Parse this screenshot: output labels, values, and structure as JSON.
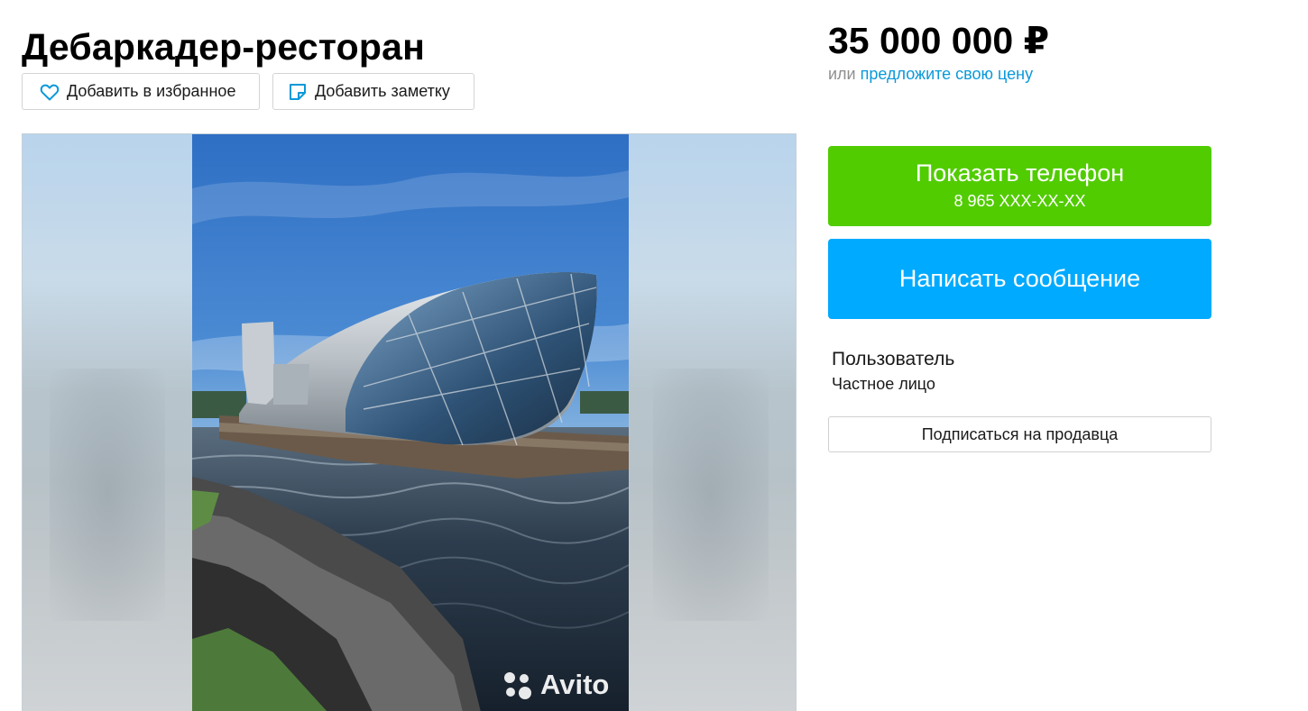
{
  "listing": {
    "title": "Дебаркадер-ресторан"
  },
  "actions": {
    "favorite_label": "Добавить в избранное",
    "note_label": "Добавить заметку",
    "favorite_icon": "heart-icon",
    "note_icon": "sticky-note-icon"
  },
  "gallery": {
    "watermark_text": "Avito",
    "watermark_icon": "avito-dots-icon"
  },
  "pricing": {
    "price": "35 000 000 ₽",
    "offer_prefix": "или",
    "offer_link": "предложите свою цену"
  },
  "contact": {
    "show_phone_label": "Показать телефон",
    "phone_masked": "8 965 XXX-XX-XX",
    "message_label": "Написать сообщение"
  },
  "seller": {
    "name": "Пользователь",
    "type": "Частное лицо",
    "subscribe_label": "Подписаться на продавца"
  },
  "colors": {
    "phone_button": "#51cc00",
    "message_button": "#00aaff",
    "link": "#0a99d9",
    "icon_accent": "#0a99d9"
  }
}
